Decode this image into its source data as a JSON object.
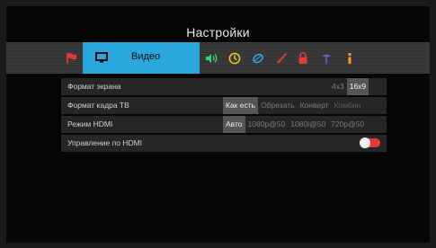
{
  "window": {
    "title": "Настройки"
  },
  "tabs": [
    {
      "icon": "flag-icon",
      "color": "#e23a3a"
    },
    {
      "icon": "tv-icon",
      "label": "Видео",
      "selected": true,
      "accent": "#2aa8de"
    },
    {
      "icon": "sound-icon",
      "color": "#2ed66f"
    },
    {
      "icon": "clock-icon",
      "color": "#e8c020"
    },
    {
      "icon": "globe-icon",
      "color": "#2aa8de"
    },
    {
      "icon": "brush-icon",
      "color": "#e23a3a"
    },
    {
      "icon": "lock-icon",
      "color": "#e23a3a"
    },
    {
      "icon": "network-icon",
      "color": "#7a55c9"
    },
    {
      "icon": "info-icon",
      "color": "#f0a020"
    }
  ],
  "settings": {
    "screen_format": {
      "label": "Формат экрана",
      "options": [
        "4x3",
        "16x9"
      ],
      "selected": "16x9"
    },
    "tv_frame_format": {
      "label": "Формат кадра ТВ",
      "options": [
        "Как есть",
        "Обрезать",
        "Конверт",
        "Комбин"
      ],
      "selected": "Как есть"
    },
    "hdmi_mode": {
      "label": "Режим HDMI",
      "options": [
        "Авто",
        "1080p@50",
        "1080i@50",
        "720p@50"
      ],
      "selected": "Авто"
    },
    "hdmi_control": {
      "label": "Управление по HDMI",
      "toggle_on": false,
      "toggle_color": "#e23a3a"
    }
  }
}
